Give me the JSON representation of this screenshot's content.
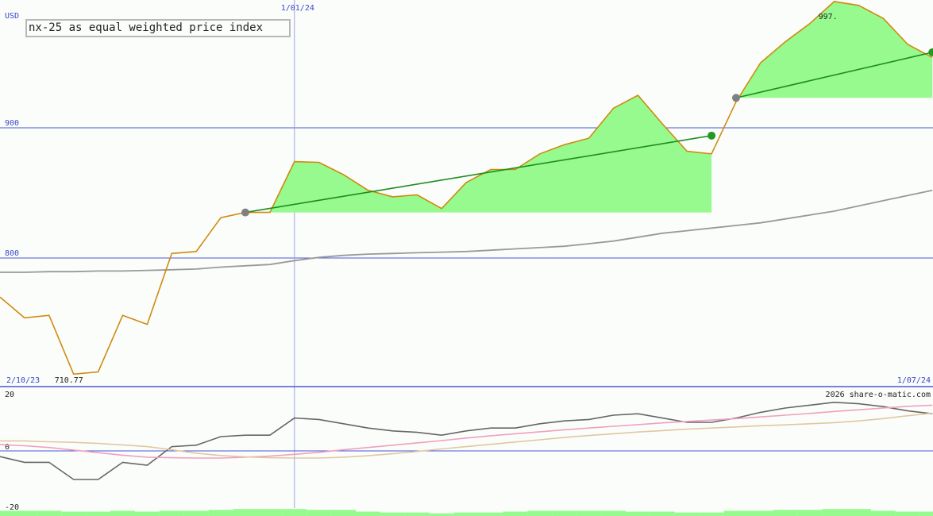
{
  "chart_title": "nx-25 as equal weighted price index",
  "chart_data": [
    {
      "type": "line",
      "ylabel": "USD",
      "ylim": [
        700,
        1000
      ],
      "y_ticks": [
        {
          "label": "900",
          "value": 900
        },
        {
          "label": "800",
          "value": 800
        }
      ],
      "x_labels": {
        "start": "2/10/23",
        "marker": "1/01/24",
        "end": "1/07/24"
      },
      "x": [
        0,
        1,
        2,
        3,
        4,
        5,
        6,
        7,
        8,
        9,
        10,
        11,
        12,
        13,
        14,
        15,
        16,
        17,
        18,
        19,
        20,
        21,
        22,
        23,
        24,
        25,
        26,
        27,
        28,
        29,
        30,
        31,
        32,
        33,
        34,
        35,
        36,
        37,
        38
      ],
      "marker_index": 12,
      "annotations": {
        "min_label": "710.77",
        "min_index": 3,
        "max_label": "997.",
        "max_index": 34
      },
      "series": [
        {
          "color": "#d08a10",
          "values": [
            770,
            754,
            756,
            710.8,
            712.5,
            756,
            749,
            803.5,
            805,
            831,
            835,
            835,
            874,
            873.5,
            864,
            852,
            847,
            848.5,
            838,
            858,
            868,
            868,
            880,
            887,
            892,
            915,
            925,
            903,
            882,
            880,
            920,
            950,
            966,
            980,
            997,
            994,
            984,
            964,
            954
          ]
        },
        {
          "color": "#999999",
          "values": [
            789,
            789,
            789.5,
            789.5,
            790,
            790,
            790.5,
            791,
            791.5,
            793,
            794,
            795,
            798,
            800.5,
            802,
            803,
            803.5,
            804,
            804.5,
            805,
            806,
            807,
            808,
            809,
            811,
            813,
            816,
            819,
            821,
            823,
            825,
            827,
            830,
            833,
            836,
            840,
            844,
            848,
            852
          ]
        }
      ],
      "fills": [
        {
          "from_index": 10,
          "to_index": 29,
          "base": 835
        },
        {
          "from_index": 30,
          "to_index": 38,
          "base": 923
        }
      ],
      "trend_lines": [
        {
          "from_index": 10,
          "from_value": 835,
          "to_index": 29,
          "to_value": 894
        },
        {
          "from_index": 30,
          "from_value": 923,
          "to_index": 38,
          "to_value": 958
        }
      ],
      "colors": {
        "fill": "#96fa8e",
        "trend": "#1e8c1e",
        "grid": "#4a58d8",
        "dot_start": "#808080",
        "dot_end": "#229922"
      }
    },
    {
      "type": "line",
      "ylim": [
        -20,
        20
      ],
      "y_ticks": [
        {
          "label": "20",
          "value": 20
        },
        {
          "label": "0",
          "value": 0
        },
        {
          "label": "-20",
          "value": -20
        }
      ],
      "watermark": "2026 share-o-matic.com",
      "series": [
        {
          "color": "#666666",
          "values": [
            -2,
            -4,
            -4,
            -10,
            -10,
            -4,
            -5,
            1.5,
            2,
            5,
            5.5,
            5.5,
            11.5,
            11,
            9.5,
            8,
            7,
            6.5,
            5.5,
            7,
            8,
            8,
            9.5,
            10.5,
            11,
            12.5,
            13,
            11.5,
            10,
            10,
            11.5,
            13.5,
            15,
            16,
            17,
            16.5,
            15.5,
            14,
            13
          ]
        },
        {
          "color": "#f0a0c0",
          "values": [
            2.2,
            1.8,
            1.2,
            0.3,
            -0.6,
            -1.5,
            -2.2,
            -2.4,
            -2.5,
            -2.5,
            -2.2,
            -1.8,
            -1.2,
            -0.5,
            0.4,
            1.2,
            2,
            2.8,
            3.6,
            4.5,
            5.3,
            6,
            6.7,
            7.4,
            8,
            8.6,
            9.2,
            9.8,
            10.3,
            10.8,
            11.3,
            11.9,
            12.5,
            13.1,
            13.8,
            14.4,
            15,
            15.6,
            16
          ]
        },
        {
          "color": "#e0c8a0",
          "values": [
            3.5,
            3.5,
            3.2,
            3,
            2.6,
            2.1,
            1.5,
            0.4,
            -0.8,
            -1.6,
            -2.1,
            -2.4,
            -2.5,
            -2.5,
            -2.2,
            -1.7,
            -1,
            -0.2,
            0.7,
            1.5,
            2.3,
            3.1,
            3.9,
            4.7,
            5.4,
            6,
            6.6,
            7.1,
            7.6,
            8,
            8.4,
            8.8,
            9.1,
            9.5,
            9.9,
            10.5,
            11.3,
            12.3,
            13.2
          ]
        }
      ],
      "volume": [
        3,
        3,
        3,
        2.5,
        2.5,
        3,
        2.5,
        3,
        3,
        3.5,
        4,
        4,
        4,
        3.5,
        3.5,
        2.5,
        2,
        2,
        1.5,
        2,
        2,
        2.5,
        3,
        3,
        3,
        3,
        2.5,
        2.5,
        2,
        2,
        3,
        3,
        3.5,
        3.5,
        4,
        4,
        3,
        2.5,
        2.5
      ]
    }
  ]
}
